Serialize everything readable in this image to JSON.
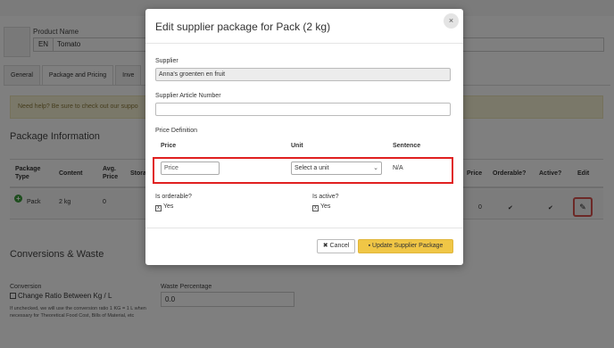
{
  "background": {
    "product_name_label": "Product Name",
    "language": "EN",
    "product_name": "Tomato",
    "tabs": [
      "General",
      "Package and Pricing",
      "Inve"
    ],
    "help_text": "Need help? Be sure to check out our suppo",
    "package_section_title": "Package Information",
    "table": {
      "headers": [
        "Package\nType",
        "Content",
        "Avg.\nPrice",
        "Stora",
        "Price",
        "Orderable?",
        "Active?",
        "Edit"
      ],
      "row": {
        "type": "Pack",
        "content": "2 kg",
        "avg_price": "0",
        "price": "0",
        "orderable": "✔",
        "active": "✔"
      }
    },
    "conversion_section_title": "Conversions & Waste",
    "conversion_label": "Conversion",
    "change_ratio_label": "Change Ratio Between Kg / L",
    "conversion_help": "If unchecked, we will use the conversion ratio 1 KG = 1 L when necessary for Theoretical Food Cost, Bills of Material, etc",
    "waste_label": "Waste Percentage",
    "waste_value": "0.0"
  },
  "modal": {
    "title": "Edit supplier package for Pack (2 kg)",
    "close": "×",
    "supplier_label": "Supplier",
    "supplier_value": "Anna's groenten en fruit",
    "article_label": "Supplier Article Number",
    "article_value": "",
    "price_definition_label": "Price Definition",
    "columns": {
      "price": "Price",
      "unit": "Unit",
      "sentence": "Sentence"
    },
    "price_placeholder": "Price",
    "unit_selected": "Select a unit",
    "sentence_value": "N/A",
    "orderable_label": "Is orderable?",
    "orderable_value": "Yes",
    "active_label": "Is active?",
    "active_value": "Yes",
    "cancel_label": "Cancel",
    "update_label": "Update Supplier Package"
  },
  "colors": {
    "highlight": "#e02020",
    "primary_button": "#f0c646",
    "success": "#3a9a3a"
  }
}
